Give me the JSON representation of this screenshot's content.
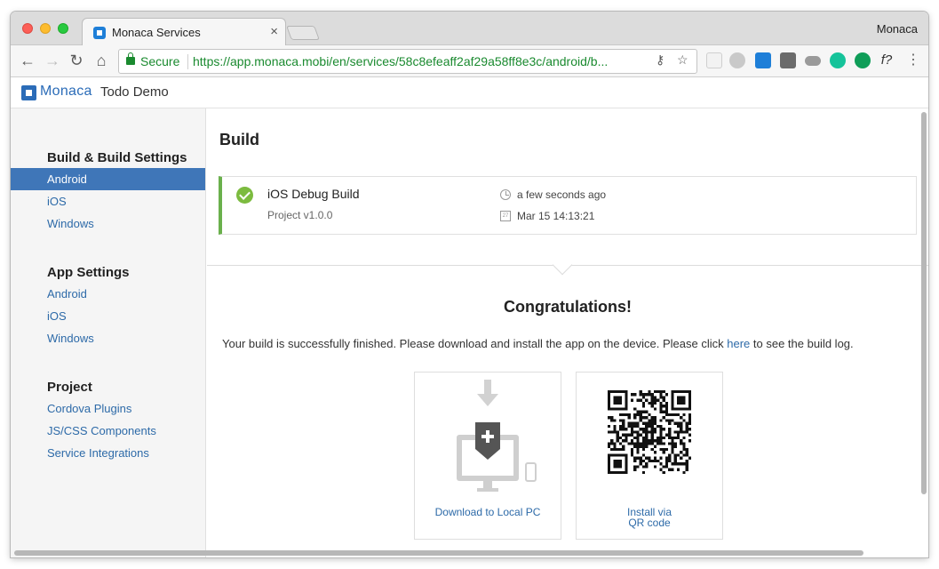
{
  "browser": {
    "tab_title": "Monaca Services",
    "tab_close": "×",
    "profile_name": "Monaca",
    "secure_label": "Secure",
    "url": "https://app.monaca.mobi/en/services/58c8efeaff2af29a58ff8e3c/android/b..."
  },
  "app": {
    "logo_text": "Monaca",
    "project_name": "Todo Demo"
  },
  "sidebar": {
    "sections": [
      {
        "title": "Build & Build Settings",
        "items": [
          "Android",
          "iOS",
          "Windows"
        ]
      },
      {
        "title": "App Settings",
        "items": [
          "Android",
          "iOS",
          "Windows"
        ]
      },
      {
        "title": "Project",
        "items": [
          "Cordova Plugins",
          "JS/CSS Components",
          "Service Integrations"
        ]
      }
    ],
    "active_item": "Build & Build Settings / Android"
  },
  "main": {
    "title": "Build",
    "build": {
      "name": "iOS Debug Build",
      "project_version": "Project v1.0.0",
      "relative_time": "a few seconds ago",
      "date": "Mar 15 14:13:21",
      "status_color": "#6ab04c"
    },
    "congrats_title": "Congratulations!",
    "message_before": "Your build is successfully finished. Please download and install the app on the device. Please click ",
    "message_link": "here",
    "message_after": " to see the build log.",
    "options": {
      "download_label": "Download to Local PC",
      "qr_label_line1": "Install via",
      "qr_label_line2": "QR code"
    }
  },
  "colors": {
    "accent": "#2b6cb8",
    "sidebar_active": "#3f76b8",
    "link": "#2d6aa8",
    "success": "#7cbb3f"
  }
}
